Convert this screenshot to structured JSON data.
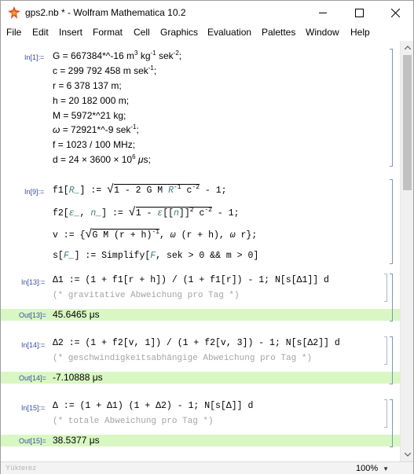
{
  "window": {
    "title": "gps2.nb * - Wolfram Mathematica 10.2",
    "controls": [
      "minimize",
      "maximize",
      "close"
    ]
  },
  "menu": [
    "File",
    "Edit",
    "Insert",
    "Format",
    "Cell",
    "Graphics",
    "Evaluation",
    "Palettes",
    "Window",
    "Help"
  ],
  "cells": {
    "in1": {
      "label": "In[1]:=",
      "lines": [
        {
          "lhs": "G",
          "rhs": "667384*^-16 m",
          "extra": "3",
          "tail": " kg",
          "e1": "-1",
          "tail2": " sek",
          "e2": "-2",
          "end": ";"
        },
        {
          "lhs": "c",
          "rhs": "299 792 458 m sek",
          "e1": "-1",
          "end": ";"
        },
        {
          "lhs": "r",
          "rhs": "6 378 137 m;"
        },
        {
          "lhs": "h",
          "rhs": "20 182 000 m;"
        },
        {
          "lhs": "M",
          "rhs": "5972*^21 kg;"
        },
        {
          "lhs": "ω",
          "rhs": "72921*^-9 sek",
          "e1": "-1",
          "end": ";"
        },
        {
          "lhs": "f",
          "rhs": "1023 / 100 MHz;"
        },
        {
          "lhs": "d",
          "rhs": "24 × 3600 × 10",
          "e1": "6",
          "end": " μs;"
        }
      ]
    },
    "in9": {
      "label": "In[9]:=",
      "f1": "f1[R_] := √(1 - 2 G M R⁻¹ c⁻²) - 1;",
      "f2": "f2[ε_, n_] := √(1 - ε[[n]]² c⁻²) - 1;",
      "v": "v := {√(G M (r + h)⁻¹), ω (r + h), ω r};",
      "s": "s[F_] := Simplify[F, sek > 0 && m > 0]"
    },
    "in13": {
      "label": "In[13]:=",
      "code": "Δ1 := (1 + f1[r + h]) / (1 + f1[r]) - 1; N[s[Δ1]] d",
      "comment": "(* gravitative Abweichung pro Tag *)",
      "out_label": "Out[13]=",
      "out_value": "45.6465 μs"
    },
    "in14": {
      "label": "In[14]:=",
      "code": "Δ2 := (1 + f2[v, 1]) / (1 + f2[v, 3]) - 1; N[s[Δ2]] d",
      "comment": "(* geschwindigkeitsabhängige Abweichung pro Tag *)",
      "out_label": "Out[14]=",
      "out_value": "-7.10888 μs"
    },
    "in15": {
      "label": "In[15]:=",
      "code": "Δ := (1 + Δ1) (1 + Δ2) - 1; N[s[Δ]] d",
      "comment": "(* totale Abweichung pro Tag *)",
      "out_label": "Out[15]=",
      "out_value": "38.5377 μs"
    }
  },
  "status": {
    "left": "Yükterez",
    "zoom": "100%"
  },
  "colors": {
    "output_bg": "#d9f7c3",
    "label": "#3a4da8",
    "comment": "#a4a4a4",
    "pattern": "#3f7f7f"
  }
}
